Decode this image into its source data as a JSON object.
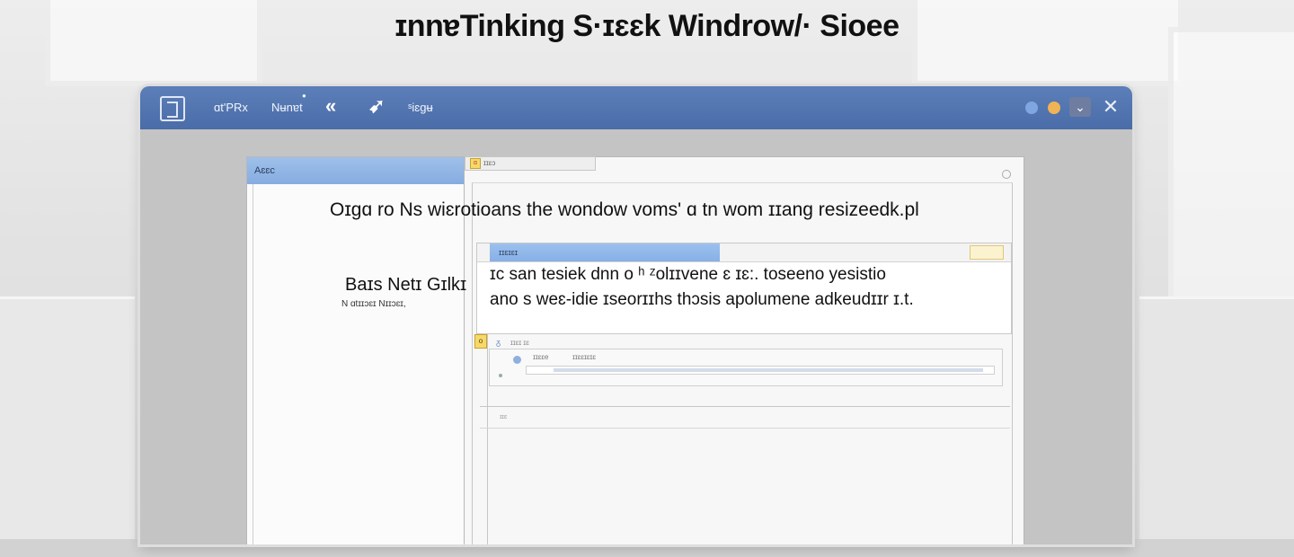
{
  "page": {
    "title": "ɪnnɐTinking S·ɪɛɛk Windrow/· Sioee"
  },
  "app": {
    "titlebar": {
      "items": [
        "ɑt'PRx",
        "Nʉnɐt",
        "ˢiɛgʉ"
      ],
      "icons": [
        "app-logo-icon",
        "double-chevron-left-icon",
        "bird-icon",
        "settings-dot-icon"
      ],
      "controls": {
        "dot_blue": "#7fa6e0",
        "dot_orange": "#f0b356",
        "dropdown": "✓",
        "close": "✕"
      }
    },
    "left_panel": {
      "header": "Aɛɛc",
      "section_title": "Baɪs Netɪ Gɪlkɪ",
      "section_sub": "N ɑtɪɪɔɛɪ Nɪɪɔɛɪ,"
    },
    "dialog": {
      "tab_label": "ɪɪɛɔ",
      "tab_badge": "ɑ",
      "headline": "Oɪgɑ ro Ns wiɛrotioans the wondow voms' ɑ tn wom ɪɪang resizeedk.pl",
      "subwindow": {
        "tab_label": "ɪɪɛɪɛɪ",
        "line1": "ɪc san tesiek dnn o ʰ ᶻolɪɪvene ɛ ɪɛ:. toseeno yesistio",
        "line2": "ano s weɛ-idie ɪseorɪɪhs thɔsis apolumene adkeudɪɪr ɪ.t."
      },
      "section_badge": "o",
      "section_label": "ɪɪɛɪ ɪɛ",
      "form": {
        "label1": "ɪɪɛɛe",
        "label2": "ɪɪɛɛɪɛɪɛ"
      },
      "footer_label": "ɪɪɛ"
    }
  },
  "colors": {
    "titlebar": "#4f70ab",
    "panel_header": "#8fb3e4",
    "badge": "#f6d96a"
  }
}
